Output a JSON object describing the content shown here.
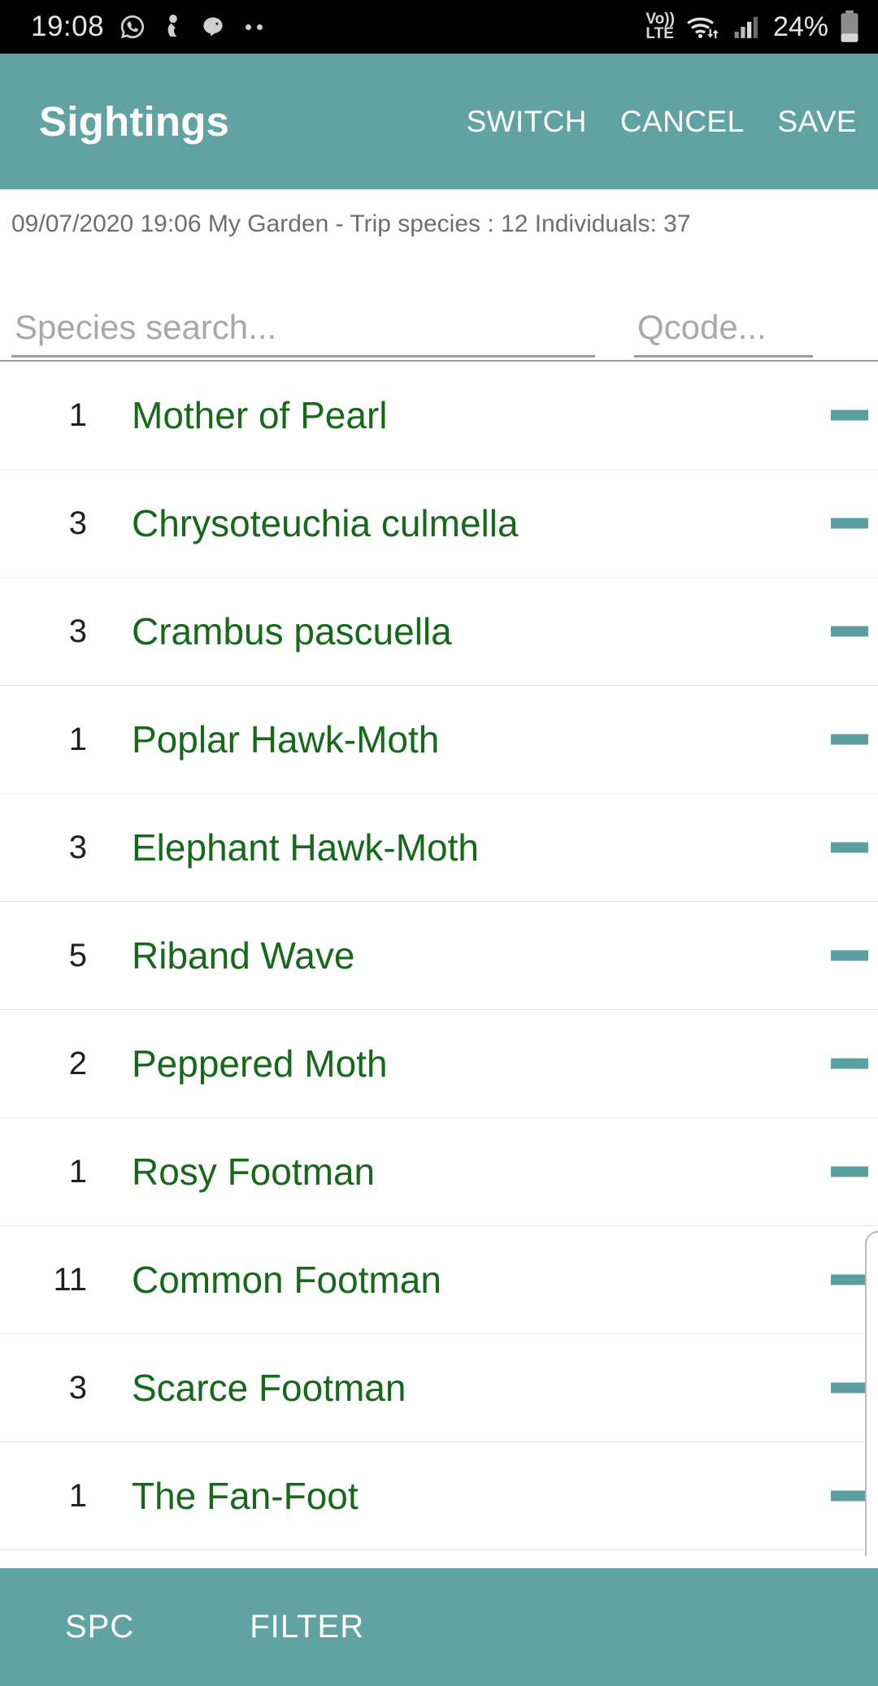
{
  "status_bar": {
    "time": "19:08",
    "network_label_top": "Vo))",
    "network_label_bottom": "LTE",
    "battery_percent": "24%",
    "icons": [
      "whatsapp-icon",
      "notification-icon",
      "bird-icon",
      "more-dots-icon",
      "volte-icon",
      "wifi-icon",
      "signal-icon",
      "battery-icon"
    ]
  },
  "app_bar": {
    "title": "Sightings",
    "switch_label": "SWITCH",
    "cancel_label": "CANCEL",
    "save_label": "SAVE"
  },
  "trip_info": {
    "text": "09/07/2020 19:06 My Garden - Trip species : 12 Individuals: 37"
  },
  "search": {
    "species_placeholder": "Species search...",
    "species_value": "",
    "qcode_placeholder": "Qcode...",
    "qcode_value": ""
  },
  "sightings": [
    {
      "count": "1",
      "species": "Mother of Pearl"
    },
    {
      "count": "3",
      "species": "Chrysoteuchia culmella"
    },
    {
      "count": "3",
      "species": "Crambus pascuella"
    },
    {
      "count": "1",
      "species": "Poplar Hawk-Moth"
    },
    {
      "count": "3",
      "species": "Elephant Hawk-Moth"
    },
    {
      "count": "5",
      "species": "Riband Wave"
    },
    {
      "count": "2",
      "species": "Peppered Moth"
    },
    {
      "count": "1",
      "species": "Rosy Footman"
    },
    {
      "count": "11",
      "species": "Common Footman"
    },
    {
      "count": "3",
      "species": "Scarce Footman"
    },
    {
      "count": "1",
      "species": "The Fan-Foot"
    }
  ],
  "bottom_bar": {
    "spc_label": "SPC",
    "filter_label": "FILTER"
  },
  "colors": {
    "accent_teal": "#61a3a3",
    "species_green": "#16681a",
    "status_bar_bg": "#000000",
    "dash_teal": "#5c9fa0"
  }
}
